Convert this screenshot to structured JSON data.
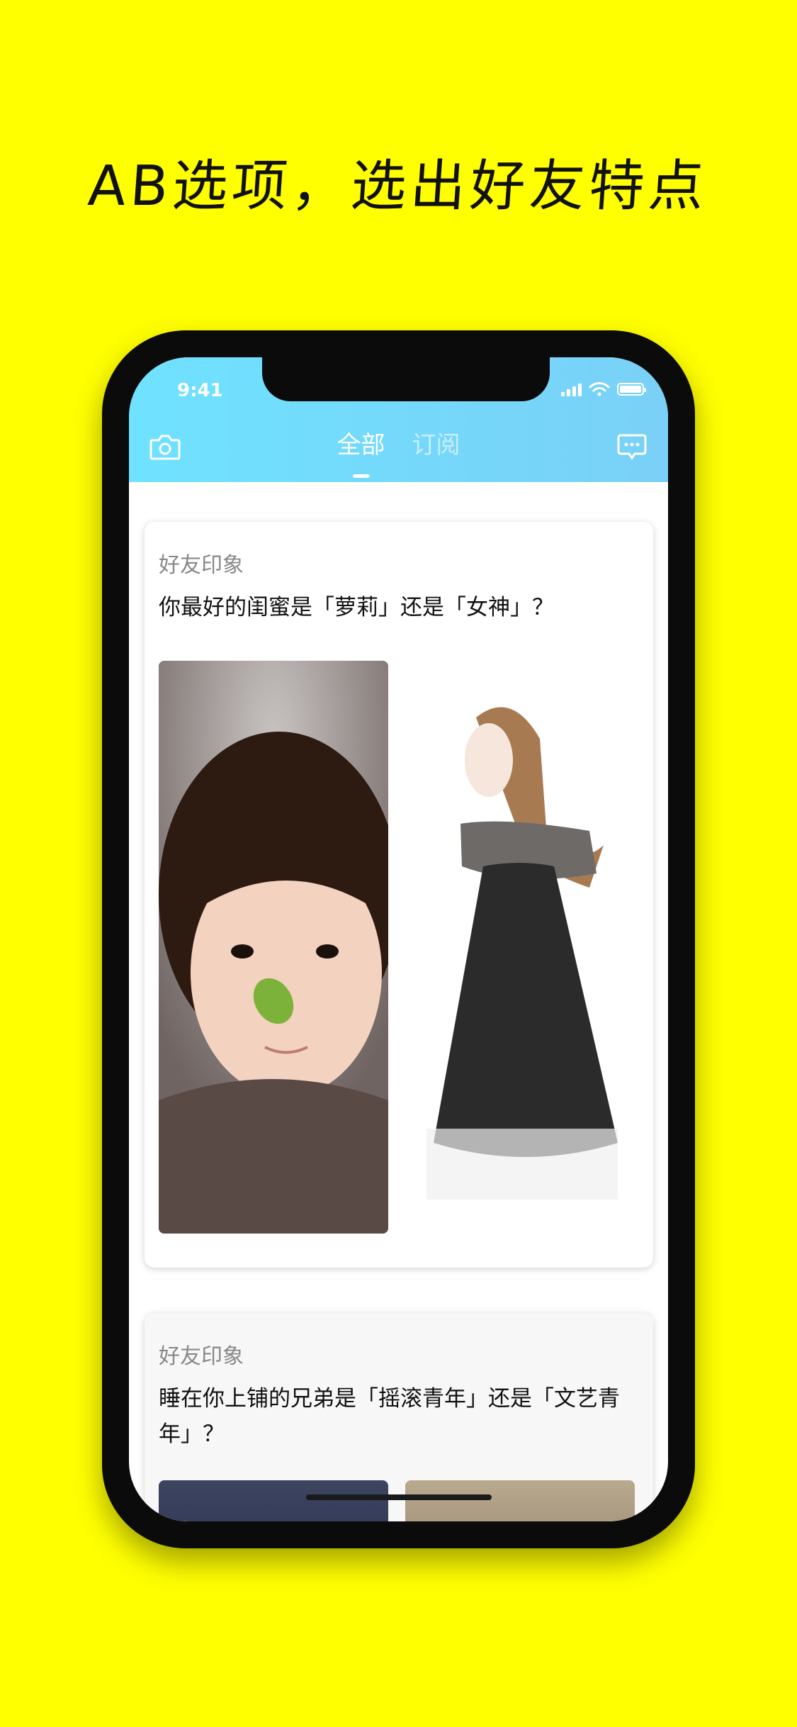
{
  "headline": "AB选项，选出好友特点",
  "status_bar": {
    "time": "9:41"
  },
  "nav": {
    "tabs": [
      {
        "label": "全部"
      },
      {
        "label": "订阅"
      }
    ],
    "left_icon": "camera-icon",
    "right_icon": "message-icon"
  },
  "cards": [
    {
      "category": "好友印象",
      "question": "你最好的闺蜜是「萝莉」还是「女神」？",
      "option_a_image": "girl-photo",
      "option_b_image": "woman-illustration"
    },
    {
      "category": "好友印象",
      "question": "睡在你上铺的兄弟是「摇滚青年」还是「文艺青年」？",
      "option_a_image": "rock-photo",
      "option_b_image": "artsy-photo"
    }
  ],
  "colors": {
    "background": "#FFFF00",
    "nav_gradient_start": "#6fe2ff",
    "nav_gradient_end": "#7ad0f7"
  }
}
